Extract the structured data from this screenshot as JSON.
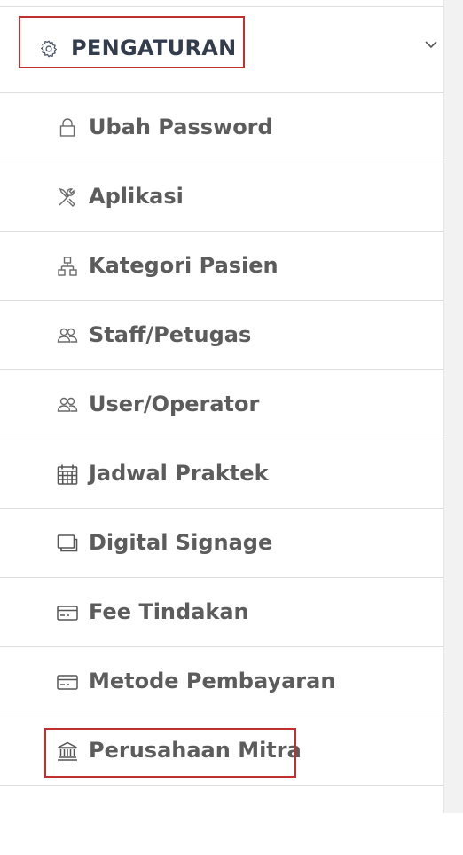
{
  "sidebar": {
    "section": {
      "title": "PENGATURAN",
      "icon": "gear-icon",
      "toggle_icon": "chevron-down-icon"
    },
    "items": [
      {
        "label": "Ubah Password",
        "icon": "lock-icon"
      },
      {
        "label": "Aplikasi",
        "icon": "tools-icon"
      },
      {
        "label": "Kategori Pasien",
        "icon": "hierarchy-icon"
      },
      {
        "label": "Staff/Petugas",
        "icon": "users-icon"
      },
      {
        "label": "User/Operator",
        "icon": "users-icon"
      },
      {
        "label": "Jadwal Praktek",
        "icon": "calendar-icon"
      },
      {
        "label": "Digital Signage",
        "icon": "windows-icon"
      },
      {
        "label": "Fee Tindakan",
        "icon": "credit-card-icon"
      },
      {
        "label": "Metode Pembayaran",
        "icon": "credit-card-icon"
      },
      {
        "label": "Perusahaan Mitra",
        "icon": "bank-icon"
      },
      {
        "label": "",
        "icon": "list-icon"
      }
    ]
  },
  "colors": {
    "highlight": "#c0302c",
    "section_text": "#333d4d",
    "item_text": "#5c5c5c",
    "icon": "#6a6a6a"
  }
}
